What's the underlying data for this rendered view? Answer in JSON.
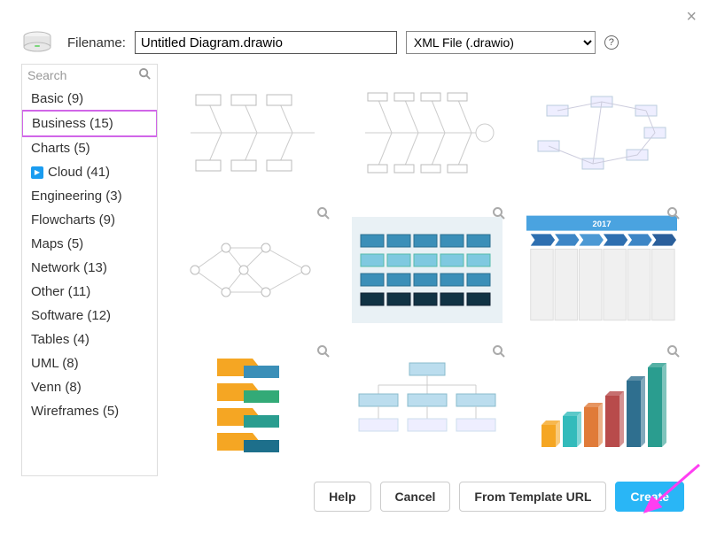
{
  "close_symbol": "×",
  "header": {
    "filename_label": "Filename:",
    "filename_value": "Untitled Diagram.drawio",
    "format_selected": "XML File (.drawio)",
    "help_symbol": "?"
  },
  "search": {
    "placeholder": "Search"
  },
  "categories": [
    {
      "label": "Basic (9)",
      "selected": false
    },
    {
      "label": "Business (15)",
      "selected": true
    },
    {
      "label": "Charts (5)",
      "selected": false
    },
    {
      "label": "Cloud (41)",
      "selected": false,
      "icon": "expand"
    },
    {
      "label": "Engineering (3)",
      "selected": false
    },
    {
      "label": "Flowcharts (9)",
      "selected": false
    },
    {
      "label": "Maps (5)",
      "selected": false
    },
    {
      "label": "Network (13)",
      "selected": false
    },
    {
      "label": "Other (11)",
      "selected": false
    },
    {
      "label": "Software (12)",
      "selected": false
    },
    {
      "label": "Tables (4)",
      "selected": false
    },
    {
      "label": "UML (8)",
      "selected": false
    },
    {
      "label": "Venn (8)",
      "selected": false
    },
    {
      "label": "Wireframes (5)",
      "selected": false
    }
  ],
  "templates": [
    {
      "name": "fishbone-1",
      "zoom": false
    },
    {
      "name": "fishbone-2",
      "zoom": false
    },
    {
      "name": "concept-map",
      "zoom": false
    },
    {
      "name": "pert",
      "zoom": true
    },
    {
      "name": "swimlane-blue",
      "zoom": true
    },
    {
      "name": "timeline-2017",
      "zoom": true,
      "title": "2017"
    },
    {
      "name": "step-process",
      "zoom": true
    },
    {
      "name": "org-chart",
      "zoom": true
    },
    {
      "name": "bar-3d",
      "zoom": true
    }
  ],
  "footer": {
    "help": "Help",
    "cancel": "Cancel",
    "from_url": "From Template URL",
    "create": "Create"
  }
}
